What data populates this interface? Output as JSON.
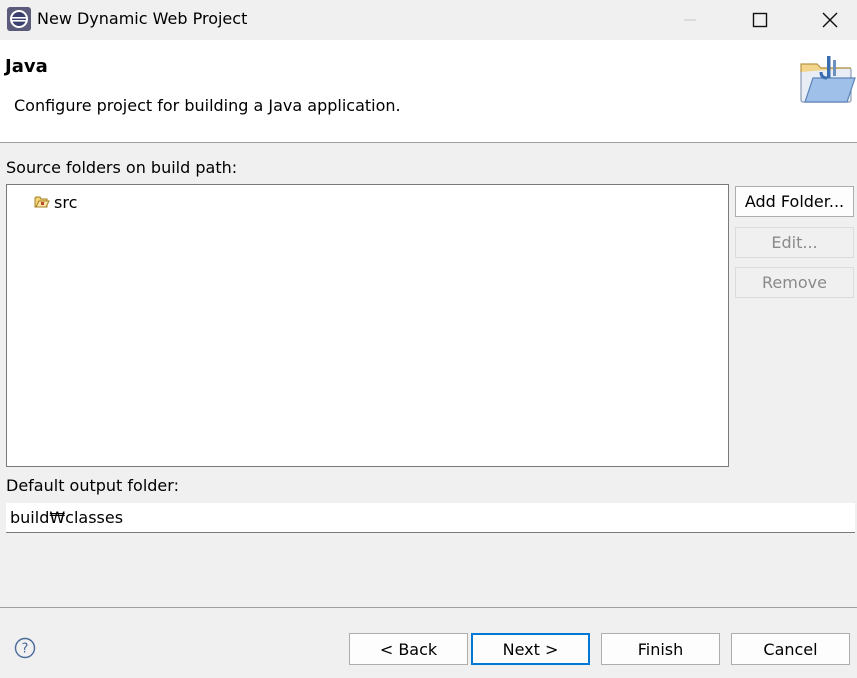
{
  "window": {
    "title": "New Dynamic Web Project",
    "app_icon": "eclipse-icon",
    "controls": [
      "minimize-icon",
      "maximize-icon",
      "close-icon"
    ]
  },
  "header": {
    "title": "Java",
    "description": "Configure project for building a Java application.",
    "icon": "java-folder-wizard-icon"
  },
  "source": {
    "label": "Source folders on build path:",
    "items": [
      {
        "label": "src",
        "icon": "source-folder-icon"
      }
    ],
    "buttons": {
      "add": "Add Folder...",
      "edit": "Edit...",
      "remove": "Remove"
    }
  },
  "output": {
    "label": "Default output folder:",
    "value": "build₩classes"
  },
  "footer": {
    "help_icon": "help-icon",
    "back": "< Back",
    "next": "Next >",
    "finish": "Finish",
    "cancel": "Cancel"
  },
  "colors": {
    "dialog_bg": "#f0f0f0",
    "panel_bg": "#ffffff",
    "focus_border": "#0078d4"
  }
}
